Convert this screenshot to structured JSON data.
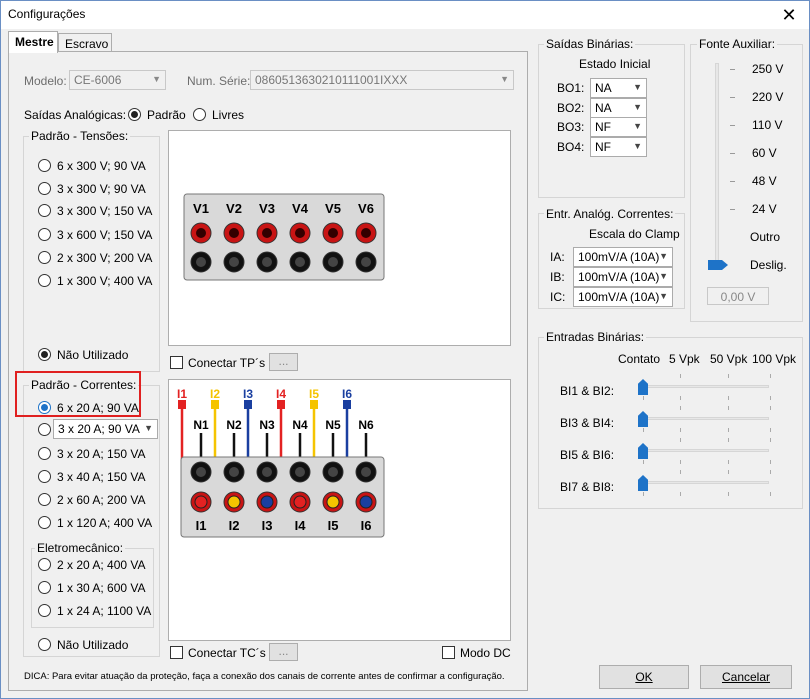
{
  "window": {
    "title": "Configurações",
    "close": "✕"
  },
  "tabs": [
    "Mestre",
    "Escravo"
  ],
  "modelo": {
    "label": "Modelo:",
    "value": "CE-6006"
  },
  "serie": {
    "label": "Num. Série:",
    "value": "0860513630210111001IXXX"
  },
  "saidas_analog": {
    "label": "Saídas Analógicas:",
    "opt1": "Padrão",
    "opt2": "Livres"
  },
  "tensoes": {
    "title": "Padrão - Tensões:",
    "options": [
      "6 x 300 V; 90 VA",
      "3 x 300 V; 90 VA",
      "3 x 300 V; 150 VA",
      "3 x 600 V; 150 VA",
      "2 x 300 V; 200 VA",
      "1 x 300 V; 400 VA"
    ],
    "nao": "Não Utilizado"
  },
  "tp": {
    "label": "Conectar TP´s",
    "btn": "..."
  },
  "voltage_labels": [
    "V1",
    "V2",
    "V3",
    "V4",
    "V5",
    "V6"
  ],
  "correntes": {
    "title": "Padrão - Correntes:",
    "options": [
      "6 x 20 A; 90 VA",
      "3 x 20 A; 150 VA",
      "3 x 40 A; 150 VA",
      "2 x 60 A; 200 VA",
      "1 x 120 A; 400 VA"
    ],
    "combo": "3 x 20 A; 90 VA",
    "eletro_title": "Eletromecânico:",
    "eletro": [
      "2 x 20 A; 400 VA",
      "1 x 30 A; 600 VA",
      "1 x 24 A; 1100 VA"
    ],
    "nao": "Não Utilizado"
  },
  "tc": {
    "label": "Conectar TC´s",
    "btn": "...",
    "modo": "Modo DC"
  },
  "current_top": [
    "I1",
    "I2",
    "I3",
    "I4",
    "I5",
    "I6"
  ],
  "neutral": [
    "N1",
    "N2",
    "N3",
    "N4",
    "N5",
    "N6"
  ],
  "current_bottom": [
    "I1",
    "I2",
    "I3",
    "I4",
    "I5",
    "I6"
  ],
  "wire_colors": [
    "#e32222",
    "#f5c400",
    "#1a3fa0",
    "#e32222",
    "#f5c400",
    "#1a3fa0"
  ],
  "dica": "DICA: Para evitar atuação da proteção, faça a conexão dos canais de corrente antes de confirmar a configuração.",
  "saidas_bin": {
    "title": "Saídas Binárias:",
    "header": "Estado Inicial",
    "rows": [
      {
        "label": "BO1:",
        "value": "NA"
      },
      {
        "label": "BO2:",
        "value": "NA"
      },
      {
        "label": "BO3:",
        "value": "NF"
      },
      {
        "label": "BO4:",
        "value": "NF"
      }
    ]
  },
  "fonte": {
    "title": "Fonte Auxiliar:",
    "levels": [
      "250 V",
      "220 V",
      "110 V",
      "60 V",
      "48 V",
      "24 V",
      "Outro",
      "Deslig."
    ],
    "value": "0,00 V"
  },
  "entr_analog": {
    "title": "Entr. Analóg. Correntes:",
    "header": "Escala do Clamp",
    "rows": [
      {
        "label": "IA:",
        "value": "100mV/A (10A)"
      },
      {
        "label": "IB:",
        "value": "100mV/A (10A)"
      },
      {
        "label": "IC:",
        "value": "100mV/A (10A)"
      }
    ]
  },
  "entradas_bin": {
    "title": "Entradas Binárias:",
    "cols": [
      "Contato",
      "5 Vpk",
      "50 Vpk",
      "100 Vpk"
    ],
    "rows": [
      "BI1 & BI2:",
      "BI3 & BI4:",
      "BI5 & BI6:",
      "BI7 & BI8:"
    ]
  },
  "buttons": {
    "ok": "OK",
    "cancel": "Cancelar"
  }
}
